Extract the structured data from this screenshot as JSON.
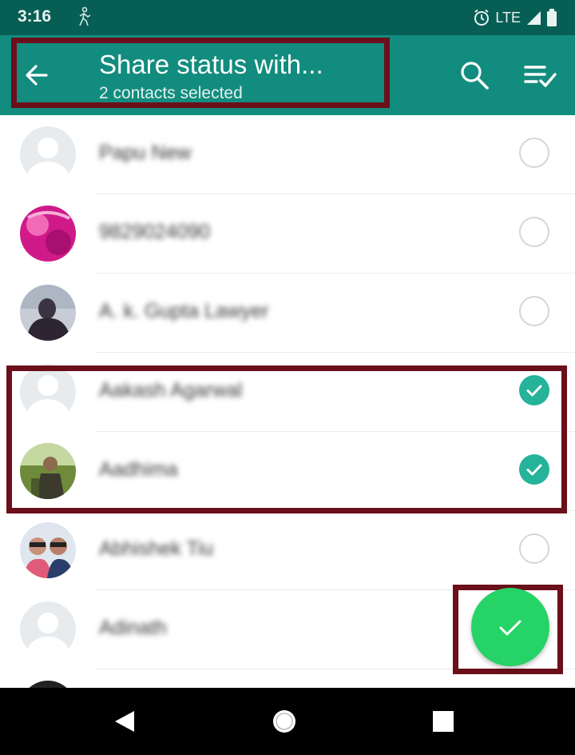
{
  "status_bar": {
    "time": "3:16",
    "network": "LTE"
  },
  "header": {
    "title": "Share status with...",
    "subtitle": "2 contacts selected"
  },
  "contacts": [
    {
      "name": "Papu New",
      "selected": false,
      "avatar": "default-avatar"
    },
    {
      "name": "9829024090",
      "selected": false,
      "avatar": "photo-avatar"
    },
    {
      "name": "A. k. Gupta Lawyer",
      "selected": false,
      "avatar": "photo-avatar"
    },
    {
      "name": "Aakash Agarwal",
      "selected": true,
      "avatar": "default-avatar"
    },
    {
      "name": "Aadhima",
      "selected": true,
      "avatar": "photo-avatar"
    },
    {
      "name": "Abhishek Tiu",
      "selected": false,
      "avatar": "photo-avatar"
    },
    {
      "name": "Adinath",
      "selected": false,
      "avatar": "default-avatar"
    }
  ],
  "colors": {
    "status_bar": "#075e54",
    "app_bar": "#128c7e",
    "check": "#25b39a",
    "fab": "#25d366",
    "highlight": "#6b0f1a"
  },
  "icons": {
    "back": "arrow-left-icon",
    "search": "search-icon",
    "select_all": "select-all-icon",
    "fab": "check-icon"
  }
}
